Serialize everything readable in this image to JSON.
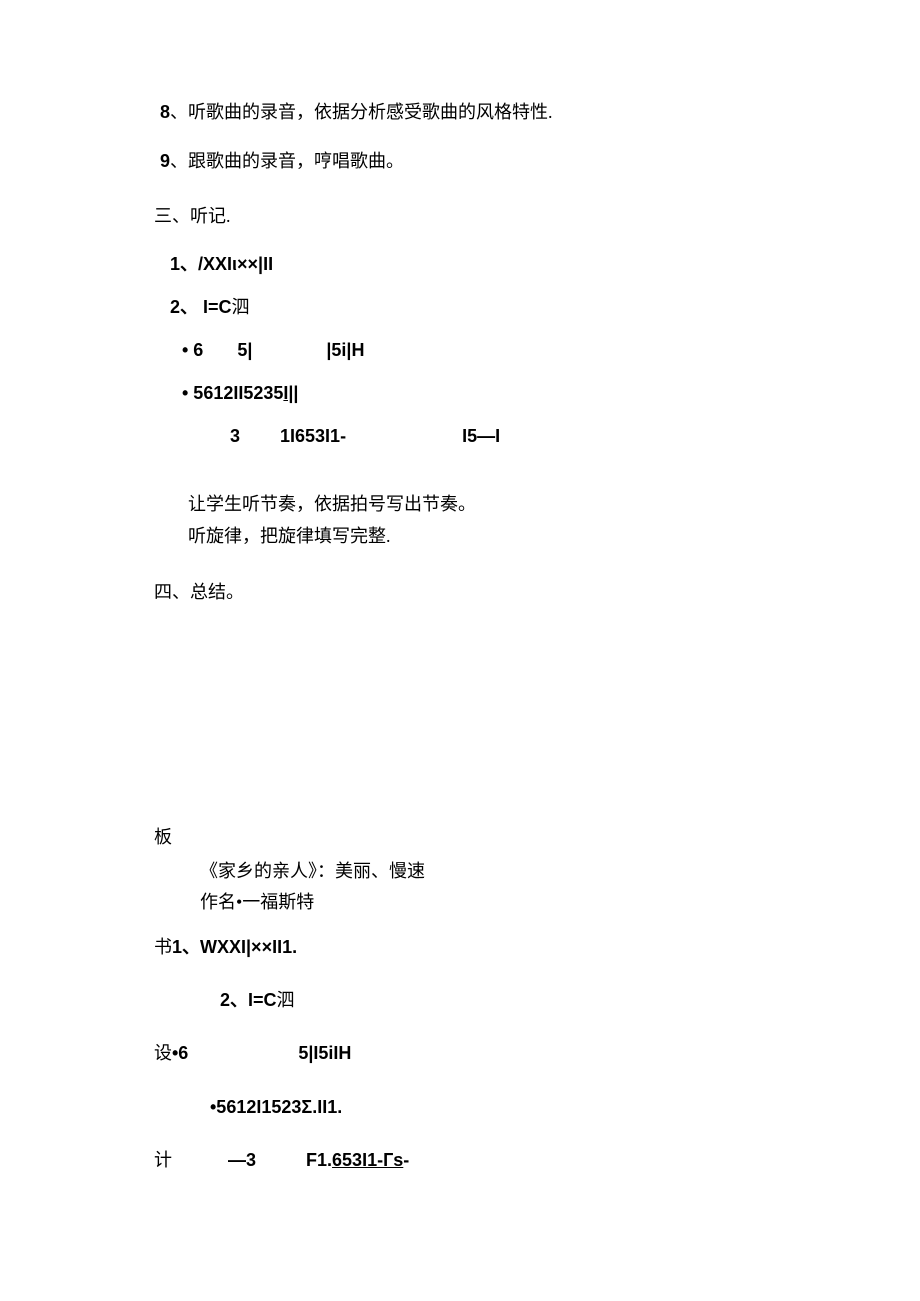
{
  "items": {
    "item8_num": "8",
    "item8_text": "、听歌曲的录音，依据分析感受歌曲的风格特性.",
    "item9_num": "9",
    "item9_text": "、跟歌曲的录音，哼唱歌曲。"
  },
  "section3": {
    "title": "三、听记.",
    "li1_num": "1",
    "li1_text": "、/XXIι××|II",
    "li2_num": "2",
    "li2_text": "、 I=C",
    "li2_suffix": "泗",
    "bullet1_a": "•    6",
    "bullet1_b": "5|",
    "bullet1_c": "|5i|H",
    "bullet2_a": "•    5612II5235",
    "bullet2_b": "I||",
    "deep_a": "3",
    "deep_b": "1I653I1-",
    "deep_c": "I5—I",
    "para1": "让学生听节奏，依据拍号写出节奏。",
    "para2": "听旋律，把旋律填写完整."
  },
  "section4": {
    "title": "四、总结。"
  },
  "board": {
    "ban": "板",
    "title": "《家乡的亲人》：美丽、慢速",
    "author": "作名•一福斯特",
    "shu": "书",
    "item1_num": "1",
    "item1_text": "、WXXI|××II1.",
    "item2_a": "2、I=C",
    "item2_b": "泗",
    "she": "设",
    "item3_a": "•6",
    "item3_b": "5|I5iIH",
    "item3b": "•5612I1523Σ.II1.",
    "ji": "计",
    "item4_a": "—3",
    "item4_b": "F1.",
    "item4_c": "653I1-Гs",
    "item4_d": "-"
  }
}
